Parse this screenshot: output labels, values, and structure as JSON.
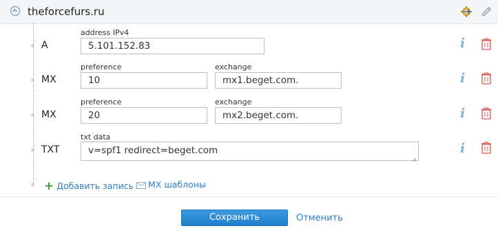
{
  "header": {
    "domain": "theforcefurs.ru",
    "icons": [
      "collapse-icon",
      "gear-settings-icon",
      "pencil-edit-icon"
    ]
  },
  "records": [
    {
      "type": "A",
      "fields": [
        {
          "label": "address IPv4",
          "value": "5.101.152.83"
        }
      ]
    },
    {
      "type": "MX",
      "fields": [
        {
          "label": "preference",
          "value": "10"
        },
        {
          "label": "exchange",
          "value": "mx1.beget.com."
        }
      ]
    },
    {
      "type": "MX",
      "fields": [
        {
          "label": "preference",
          "value": "20"
        },
        {
          "label": "exchange",
          "value": "mx2.beget.com."
        }
      ]
    },
    {
      "type": "TXT",
      "fields": [
        {
          "label": "txt data",
          "value": "v=spf1 redirect=beget.com"
        }
      ]
    }
  ],
  "row_icons": {
    "info": "i",
    "delete": "trash-icon"
  },
  "actions": {
    "add_record": "Добавить запись",
    "mx_templates": "MX шаблоны",
    "save": "Сохранить",
    "cancel": "Отменить"
  },
  "colors": {
    "accent": "#1d7fc9",
    "link": "#2a7cc4",
    "plus": "#3ba53b",
    "delete": "#d9534f",
    "info": "#7fb3d9"
  }
}
